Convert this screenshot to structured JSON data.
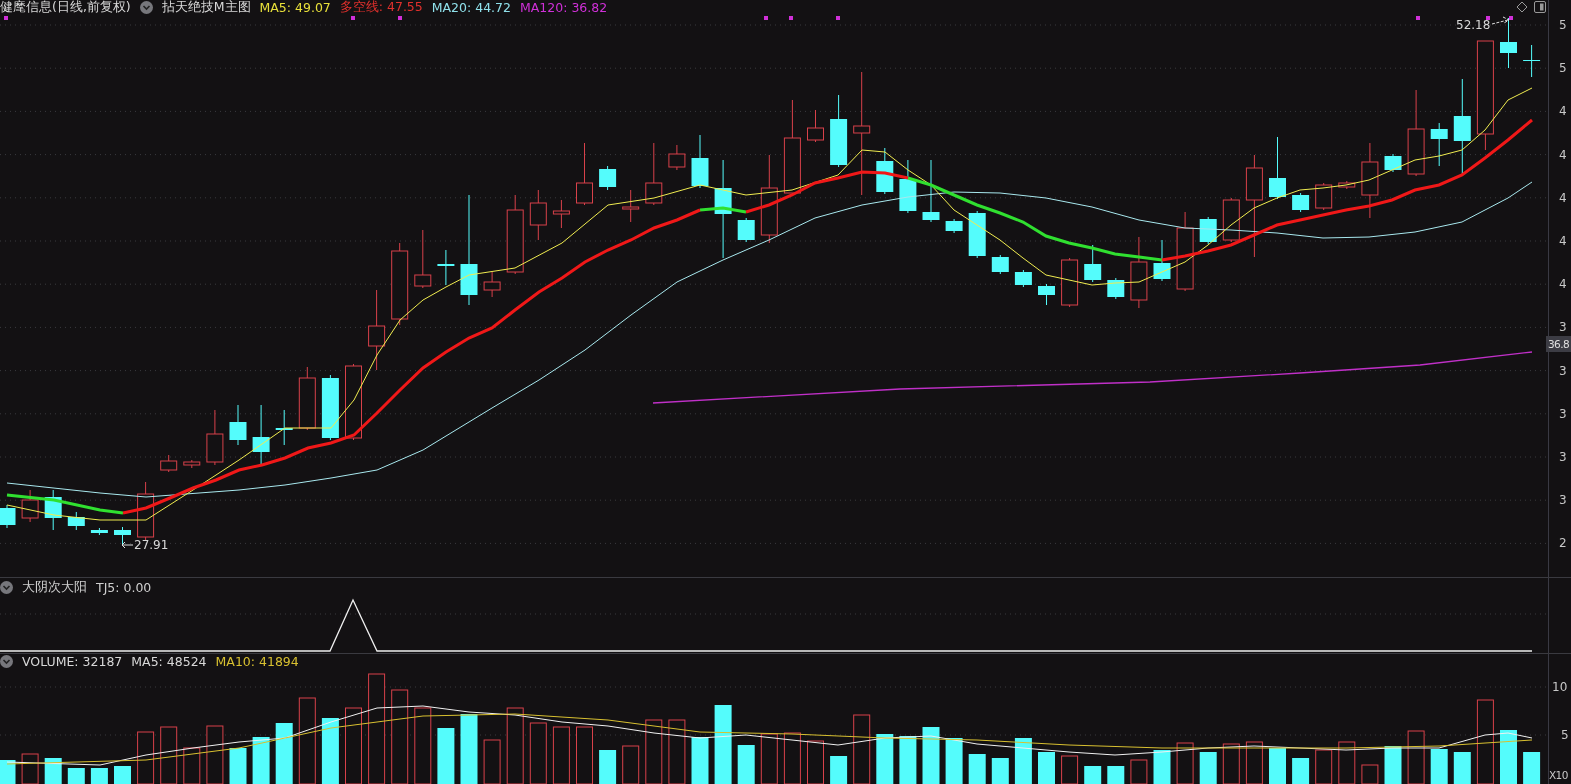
{
  "main_panel": {
    "title": "健麾信息(日线,前复权)",
    "indicator": "拈天绝技M主图",
    "legend": [
      {
        "text": "MA5: 49.07",
        "color": "#e8e03a"
      },
      {
        "text": "多空线: 47.55",
        "color": "#e0302c"
      },
      {
        "text": "MA20: 44.72",
        "color": "#8fe0ea"
      },
      {
        "text": "MA120: 36.82",
        "color": "#d030d8"
      }
    ],
    "high_label": "52.18",
    "low_label": "27.91",
    "axis_labels": [
      "5",
      "5",
      "4",
      "4",
      "4",
      "4",
      "4",
      "3",
      "3",
      "3",
      "3",
      "3",
      "2"
    ],
    "current_tag": "36.8"
  },
  "signal_panel": {
    "name": "大阴次大阳",
    "value": "TJ5: 0.00"
  },
  "volume_panel": {
    "legend": [
      {
        "text": "VOLUME: 32187",
        "color": "#d8d8d8"
      },
      {
        "text": "MA5: 48524",
        "color": "#d8d8d8"
      },
      {
        "text": "MA10: 41894",
        "color": "#d8c030"
      }
    ],
    "axis_labels": [
      "10",
      "5"
    ],
    "unit": "X10"
  }
}
